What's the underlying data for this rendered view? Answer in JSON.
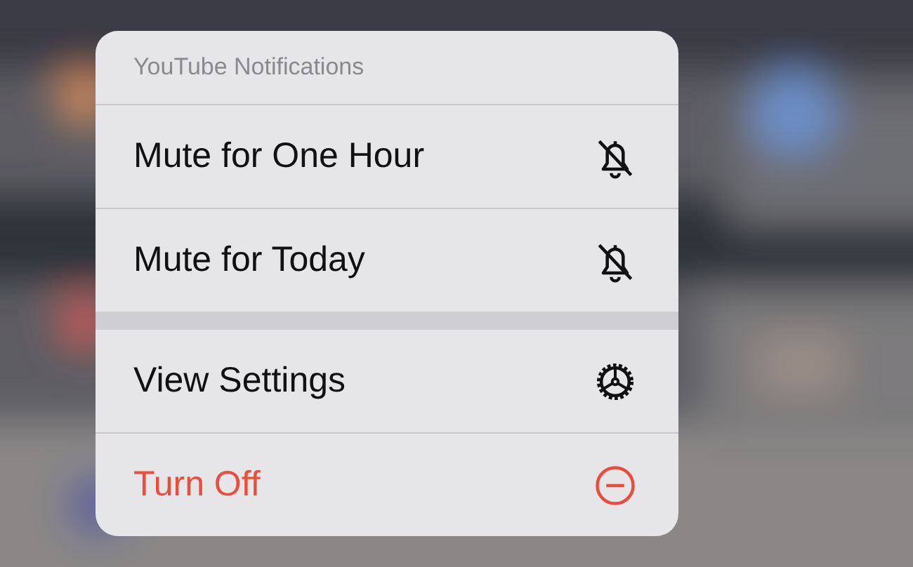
{
  "menu": {
    "title": "YouTube Notifications",
    "sections": [
      {
        "items": [
          {
            "label": "Mute for One Hour",
            "destructive": false
          },
          {
            "label": "Mute for Today",
            "destructive": false
          }
        ]
      },
      {
        "items": [
          {
            "label": "View Settings",
            "destructive": false
          },
          {
            "label": "Turn Off",
            "destructive": true
          }
        ]
      }
    ]
  }
}
